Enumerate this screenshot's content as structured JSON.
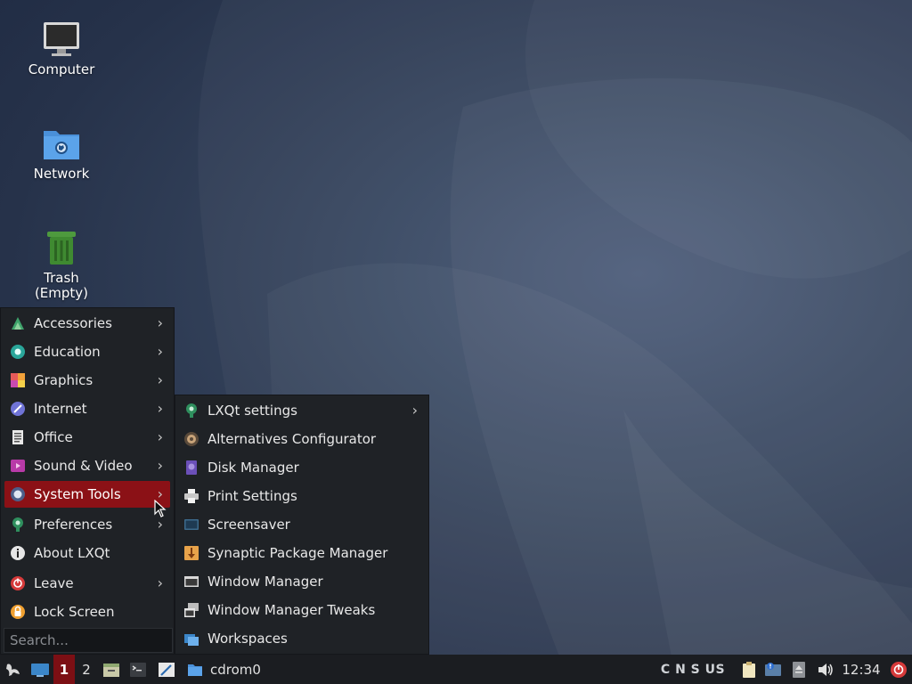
{
  "desktop": {
    "icons": [
      {
        "label": "Computer",
        "icon": "monitor-icon"
      },
      {
        "label": "Network",
        "icon": "network-folder-icon"
      },
      {
        "label": "Trash\n(Empty)",
        "icon": "trash-icon"
      }
    ]
  },
  "main_menu": {
    "items": [
      {
        "label": "Accessories",
        "icon": "accessories-icon",
        "submenu": true
      },
      {
        "label": "Education",
        "icon": "education-icon",
        "submenu": true
      },
      {
        "label": "Graphics",
        "icon": "graphics-icon",
        "submenu": true
      },
      {
        "label": "Internet",
        "icon": "internet-icon",
        "submenu": true
      },
      {
        "label": "Office",
        "icon": "office-icon",
        "submenu": true
      },
      {
        "label": "Sound & Video",
        "icon": "sound-video-icon",
        "submenu": true
      },
      {
        "label": "System Tools",
        "icon": "system-tools-icon",
        "submenu": true,
        "active": true
      },
      {
        "label": "Preferences",
        "icon": "preferences-icon",
        "submenu": true
      },
      {
        "label": "About LXQt",
        "icon": "info-icon",
        "submenu": false
      },
      {
        "label": "Leave",
        "icon": "leave-icon",
        "submenu": true
      },
      {
        "label": "Lock Screen",
        "icon": "lock-icon",
        "submenu": false
      }
    ],
    "search_placeholder": "Search...",
    "arrow": "›"
  },
  "system_tools_menu": {
    "items": [
      {
        "label": "LXQt settings",
        "icon": "lxqt-settings-icon",
        "submenu": true
      },
      {
        "label": "Alternatives Configurator",
        "icon": "alternatives-icon"
      },
      {
        "label": "Disk Manager",
        "icon": "disk-manager-icon"
      },
      {
        "label": "Print Settings",
        "icon": "printer-icon"
      },
      {
        "label": "Screensaver",
        "icon": "screensaver-icon"
      },
      {
        "label": "Synaptic Package Manager",
        "icon": "synaptic-icon"
      },
      {
        "label": "Window Manager",
        "icon": "window-manager-icon"
      },
      {
        "label": "Window Manager Tweaks",
        "icon": "wm-tweaks-icon"
      },
      {
        "label": "Workspaces",
        "icon": "workspaces-icon"
      }
    ]
  },
  "taskbar": {
    "workspace_1": "1",
    "workspace_2": "2",
    "window_title": "cdrom0",
    "keyboard_indicators": "C N S US",
    "clock": "12:34"
  },
  "colors": {
    "menu_bg": "#1f2226",
    "active_item": "#8b1116",
    "taskbar_bg": "#1b1d21"
  }
}
